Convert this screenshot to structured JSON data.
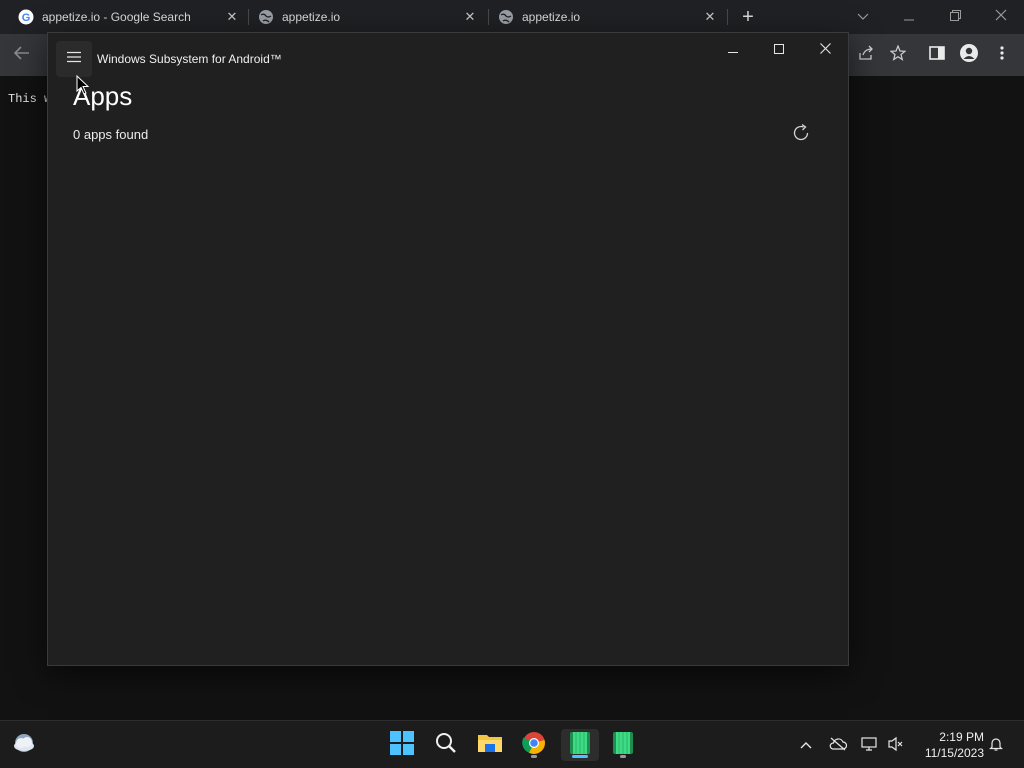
{
  "browser": {
    "tabs": [
      {
        "title": "appetize.io - Google Search",
        "icon": "google-icon"
      },
      {
        "title": "appetize.io",
        "icon": "globe-icon"
      },
      {
        "title": "appetize.io",
        "icon": "globe-icon"
      }
    ],
    "tab_close_glyph": "✕",
    "new_tab_glyph": "+",
    "page_text": "This w"
  },
  "wsa": {
    "title": "Windows Subsystem for Android™",
    "heading": "Apps",
    "count_text": "0 apps found"
  },
  "taskbar": {
    "time": "2:19 PM",
    "date": "11/15/2023"
  },
  "colors": {
    "window_bg": "#202020",
    "accent_blue": "#4cc2ff",
    "android_green": "#3ddc84"
  }
}
